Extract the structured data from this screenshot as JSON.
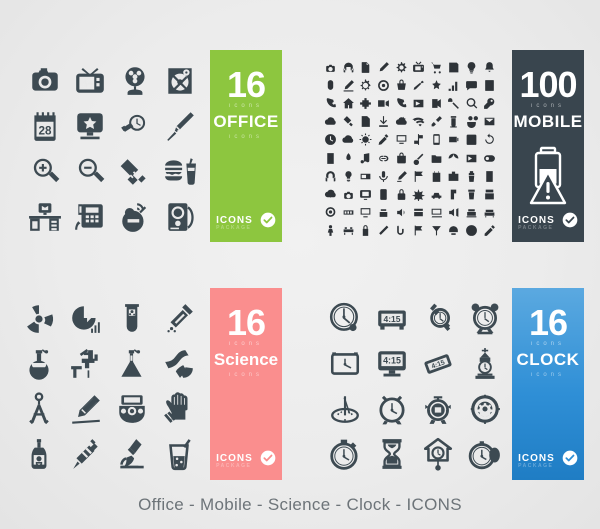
{
  "caption": "Office -  Mobile - Science - Clock - ICONS",
  "colors": {
    "background": "#ececec",
    "icon": "#3d4a52",
    "office": "#8dc63f",
    "mobile": "#39454e",
    "science": "#fa8e8e",
    "clock": "#2f8fd6",
    "caption_text": "#6d7479"
  },
  "panels": [
    {
      "id": "office",
      "count": "16",
      "count_sub": "icons",
      "category": "OFFICE",
      "category_sub": "icons",
      "footer_label": "ICONS",
      "footer_ghost": "PACKAGE",
      "badge": "check-icon",
      "icons": [
        "photo-camera-icon",
        "television-icon",
        "electric-fan-icon",
        "hard-disk-icon",
        "calendar-28-icon",
        "monitor-star-icon",
        "wristwatch-icon",
        "fountain-pen-icon",
        "zoom-in-icon",
        "zoom-out-icon",
        "usb-flash-drive-icon",
        "burger-drink-icon",
        "office-desk-icon",
        "desk-phone-icon",
        "support-headset-icon",
        "speaker-icon"
      ]
    },
    {
      "id": "mobile",
      "count": "100",
      "count_sub": "icons",
      "category": "MOBILE",
      "category_sub": "",
      "footer_label": "ICONS",
      "footer_ghost": "PACKAGE",
      "badge": "check-icon",
      "graphic": "battery-warning-icon",
      "icon_count": 100,
      "icons": [
        "camera-icon",
        "headphones-icon",
        "document-icon",
        "pen-icon",
        "gear-icon",
        "tv-icon",
        "shopping-cart-icon",
        "save-icon",
        "bulb-icon",
        "bell-icon",
        "mouse-icon",
        "pencil-icon",
        "cog-icon",
        "target-icon",
        "basket-icon",
        "brush-icon",
        "award-icon",
        "chart-icon",
        "chat-icon",
        "calculator-icon",
        "phone-call-icon",
        "home-icon",
        "puzzle-icon",
        "video-icon",
        "phone-icon",
        "photo-frame-icon",
        "arrow-icon",
        "hand-icon",
        "search-icon",
        "key-icon",
        "cloud-icon",
        "usb-icon",
        "book-icon",
        "download-icon",
        "weather-icon",
        "wifi-icon",
        "tools-icon",
        "coffee-icon",
        "binoculars-icon",
        "mail-icon",
        "clock-icon",
        "cloud2-icon",
        "sun-icon",
        "syringe-icon",
        "screen-icon",
        "signpost-icon",
        "mobile-phone-icon",
        "battery-icon",
        "calendar-icon",
        "refresh-icon",
        "radio-icon",
        "plant-icon",
        "music-note-icon",
        "link-icon",
        "bag-icon",
        "guitar-icon",
        "folder-open-icon",
        "leaf-icon",
        "photo-icon",
        "capsule-icon",
        "headset-icon",
        "lamp-icon",
        "card-icon",
        "microphone-icon",
        "marker-icon",
        "flag-icon",
        "clipboard-icon",
        "briefcase-icon",
        "trophy-icon",
        "sd-card-icon",
        "cloud-upload-icon",
        "camera2-icon",
        "tablet-icon",
        "remote-icon",
        "lock-icon",
        "star-burst-icon",
        "car-icon",
        "switch-icon",
        "trash-icon",
        "battery2-icon",
        "gear2-icon",
        "keyboard-icon",
        "laptop-icon",
        "printer-icon",
        "speaker2-icon",
        "store-icon",
        "image-icon",
        "megaphone-icon",
        "sofa-icon",
        "bench-icon",
        "person-icon",
        "bench2-icon",
        "lock2-icon",
        "ruler-icon",
        "hand2-icon",
        "flag2-icon",
        "cocktail-icon",
        "magnet-icon",
        "compass-icon",
        "wand-icon"
      ]
    },
    {
      "id": "science",
      "count": "16",
      "count_sub": "icons",
      "category": "Science",
      "category_sub": "icons",
      "footer_label": "ICONS",
      "footer_ghost": "PACKAGE",
      "badge": "check-icon",
      "icons": [
        "radiation-icon",
        "pie-chart-icon",
        "test-tube-icon",
        "dropper-icon",
        "round-flask-icon",
        "faucet-icon",
        "erlenmeyer-flask-icon",
        "dna-magnet-icon",
        "compass-divider-icon",
        "pencil-icon",
        "gas-mask-icon",
        "safety-glove-icon",
        "poison-bottle-icon",
        "syringe-icon",
        "microscope-icon",
        "beaker-straw-icon"
      ]
    },
    {
      "id": "clock",
      "count": "16",
      "count_sub": "icons",
      "category": "CLOCK",
      "category_sub": "icons",
      "footer_label": "ICONS",
      "footer_ghost": "PACKAGE",
      "badge": "check-icon",
      "digital_time": "4:15",
      "icons": [
        "wall-clock-icon",
        "digital-clock-icon",
        "wristwatch-icon",
        "twin-bell-alarm-icon",
        "square-clock-icon",
        "monitor-clock-icon",
        "tilted-digital-clock-icon",
        "tower-clock-icon",
        "sundial-icon",
        "alarm-clock-icon",
        "ringing-alarm-icon",
        "gear-clock-icon",
        "stopwatch-icon",
        "hourglass-icon",
        "cuckoo-clock-icon",
        "pocket-watch-icon"
      ]
    }
  ]
}
